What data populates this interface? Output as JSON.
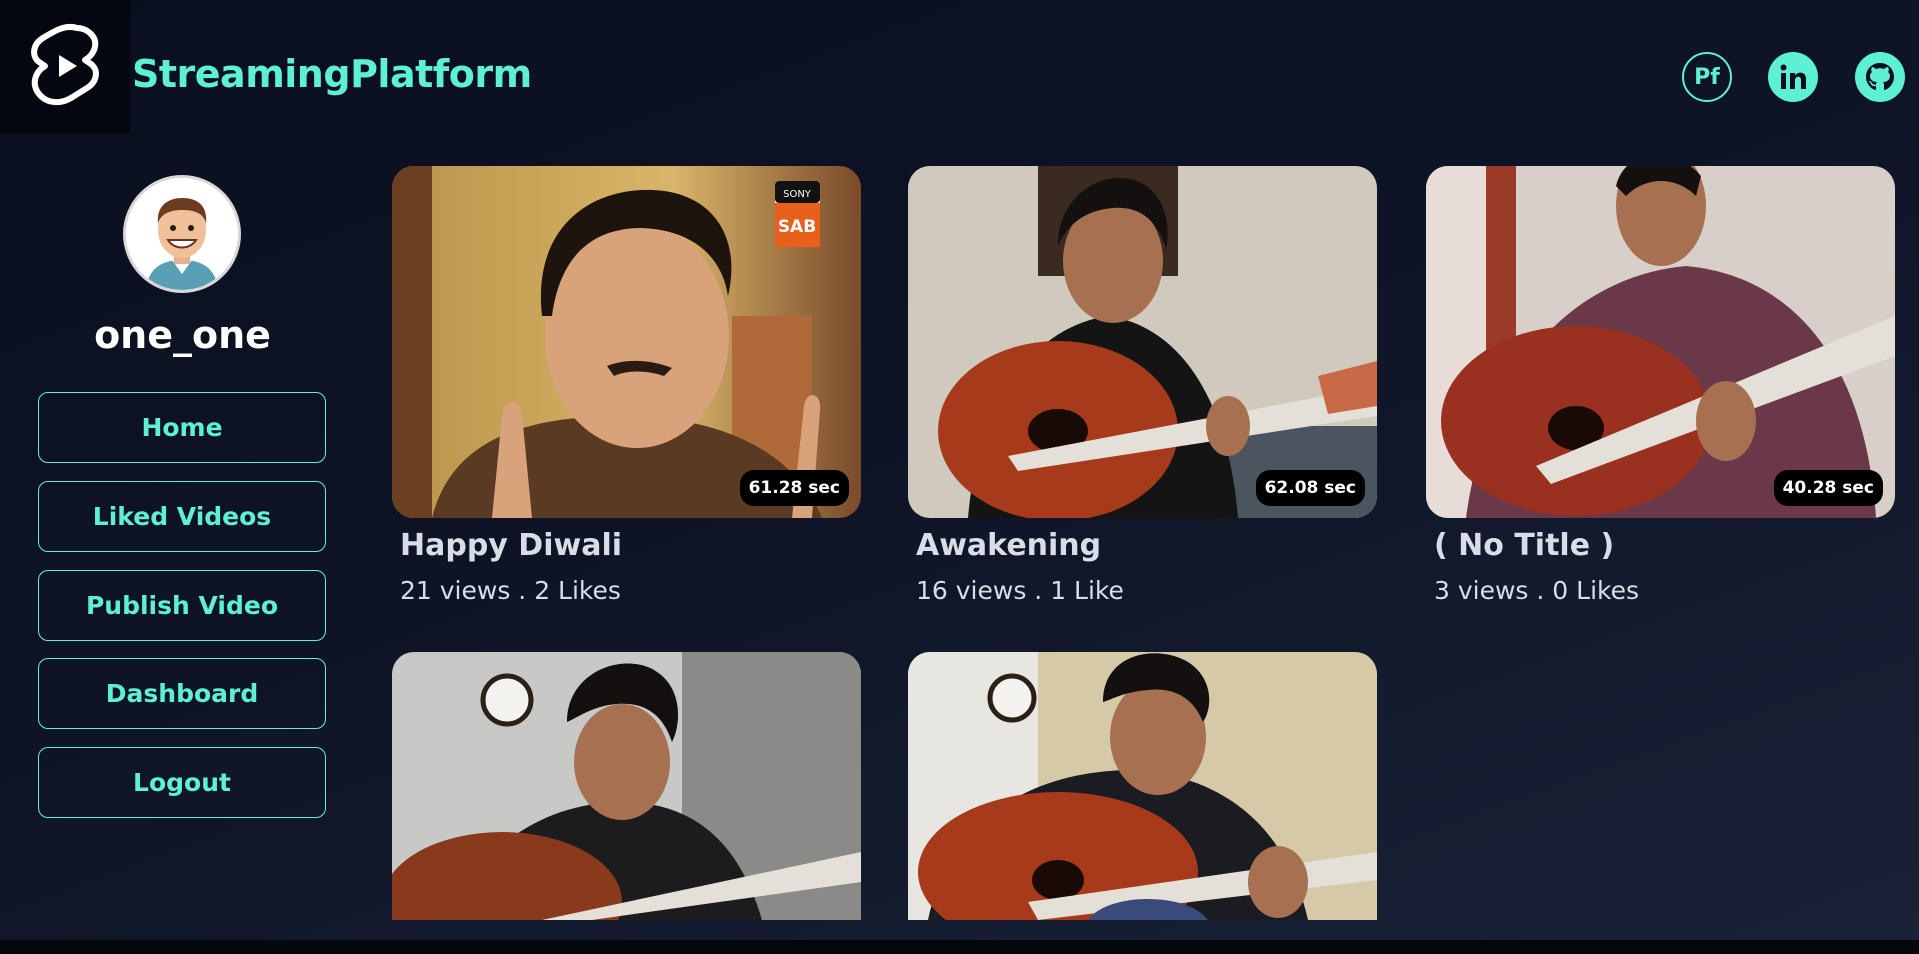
{
  "header": {
    "brand": "StreamingPlatform",
    "logo_icon": "play-logo-icon",
    "socials": [
      {
        "label": "Pf",
        "icon": "portfolio-icon"
      },
      {
        "label": "in",
        "icon": "linkedin-icon"
      },
      {
        "label": "",
        "icon": "github-icon"
      }
    ]
  },
  "sidebar": {
    "username": "one_one",
    "nav": [
      {
        "label": "Home"
      },
      {
        "label": "Liked Videos"
      },
      {
        "label": "Publish Video"
      },
      {
        "label": "Dashboard"
      },
      {
        "label": "Logout"
      }
    ]
  },
  "videos": [
    {
      "title": "Happy Diwali",
      "meta": "21 views . 2 Likes",
      "duration": "61.28 sec",
      "badge_top": "SONY",
      "badge_bottom": "SAB"
    },
    {
      "title": "Awakening",
      "meta": "16 views . 1 Like",
      "duration": "62.08 sec"
    },
    {
      "title": "( No Title )",
      "meta": "3 views . 0 Likes",
      "duration": "40.28 sec"
    },
    {
      "title": "",
      "meta": "",
      "duration": ""
    },
    {
      "title": "",
      "meta": "",
      "duration": ""
    }
  ],
  "colors": {
    "accent": "#5ef0d4",
    "background": "#0d1426",
    "text": "#d8dde6"
  }
}
